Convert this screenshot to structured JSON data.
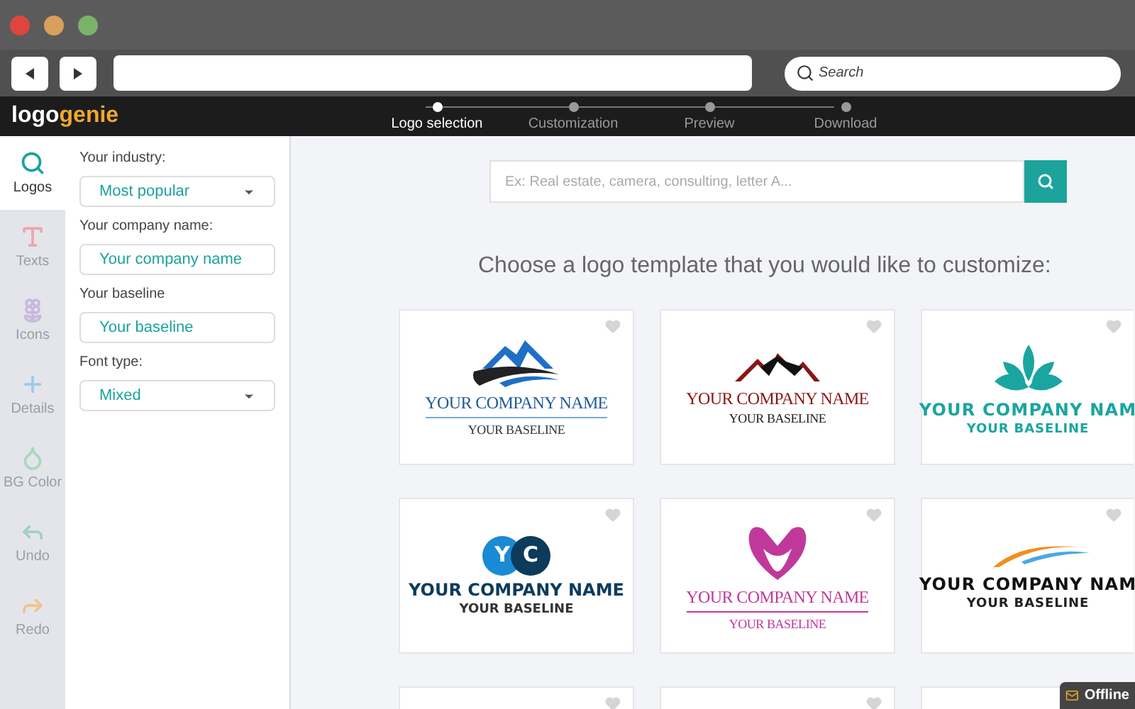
{
  "browser": {
    "search_placeholder": "Search"
  },
  "app": {
    "logo": {
      "part_1": "logo",
      "part_2": "genie"
    },
    "steps": [
      {
        "label": "Logo selection",
        "selected": true
      },
      {
        "label": "Customization",
        "selected": false
      },
      {
        "label": "Preview",
        "selected": false
      },
      {
        "label": "Download",
        "selected": false
      }
    ]
  },
  "tools": [
    {
      "label": "Logos",
      "kind": "search",
      "color": "#1ba39c",
      "selected": true
    },
    {
      "label": "Texts",
      "kind": "text",
      "color": "#f0a5ad",
      "selected": false
    },
    {
      "label": "Icons",
      "kind": "icons",
      "color": "#c9b8dd",
      "selected": false
    },
    {
      "label": "Details",
      "kind": "details",
      "color": "#9ccbe8",
      "selected": false
    },
    {
      "label": "BG Color",
      "kind": "bgcolor",
      "color": "#a8d8c0",
      "selected": false
    },
    {
      "label": "Undo",
      "kind": "undo",
      "color": "#9fd1c4",
      "selected": false
    },
    {
      "label": "Redo",
      "kind": "redo",
      "color": "#f3c28f",
      "selected": false
    }
  ],
  "form": [
    {
      "label": "Your industry:",
      "kind": "select",
      "value": "Most popular"
    },
    {
      "label": "Your company name:",
      "kind": "text",
      "value": "Your company name"
    },
    {
      "label": "Your baseline",
      "kind": "text",
      "value": "Your baseline"
    },
    {
      "label": "Font type:",
      "kind": "select",
      "value": "Mixed"
    }
  ],
  "search": {
    "placeholder": "Ex: Real estate, camera, consulting, letter A..."
  },
  "heading": "Choose a logo template that you would like to customize:",
  "templates": [
    {
      "company": "YOUR COMPANY NAME",
      "baseline": "YOUR BASELINE",
      "color": "#1f5b9a",
      "favorite": false
    },
    {
      "company": "YOUR COMPANY NAME",
      "baseline": "YOUR BASELINE",
      "color": "#8b1414",
      "favorite": false
    },
    {
      "company": "YOUR COMPANY NAM",
      "baseline": "YOUR BASELINE",
      "color": "#1ba5a0",
      "favorite": false
    },
    {
      "letters": [
        "Y",
        "C"
      ],
      "company": "YOUR COMPANY NAME",
      "baseline": "YOUR BASELINE",
      "color": "#0d3b5c",
      "favorite": false
    },
    {
      "company": "YOUR COMPANY NAME",
      "baseline": "YOUR BASELINE",
      "color": "#c0399a",
      "favorite": false
    },
    {
      "company": "YOUR COMPANY NAM",
      "baseline": "YOUR BASELINE",
      "color": "#111111",
      "favorite": false
    },
    {
      "favorite": false
    },
    {
      "favorite": false
    }
  ],
  "chat": {
    "label": "Offline"
  }
}
